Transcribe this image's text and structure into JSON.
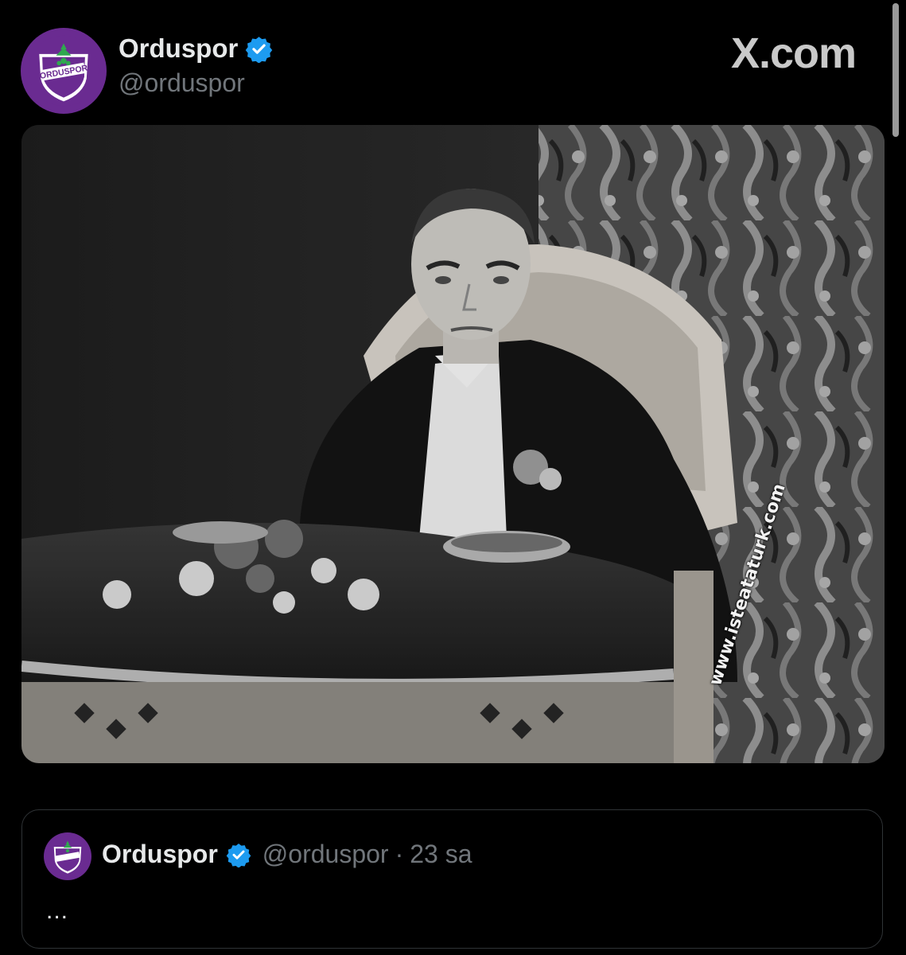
{
  "post": {
    "author_name": "Orduspor",
    "author_handle": "@orduspor",
    "source_label": "X.com",
    "avatar_icon": "orduspor-logo",
    "verified_icon": "verified-badge-icon",
    "verified_color": "#1d9bf0",
    "avatar_color": "#6a2b91"
  },
  "photo": {
    "watermark": "www.isteataturk.com"
  },
  "quoted": {
    "author_name": "Orduspor",
    "author_handle": "@orduspor",
    "separator": "·",
    "time": "23 sa",
    "body": "..."
  }
}
